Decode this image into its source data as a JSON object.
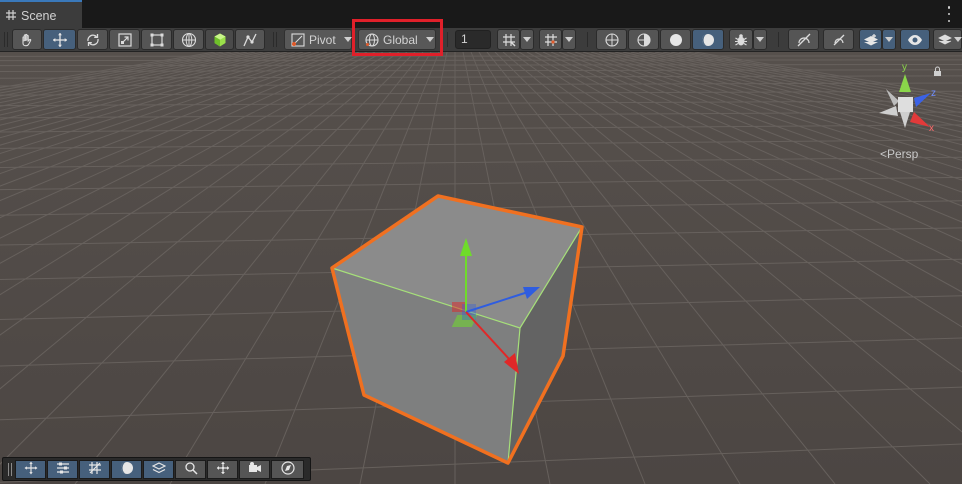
{
  "tab": {
    "title": "Scene"
  },
  "toolbar": {
    "tools": [
      "view-tool",
      "move-tool",
      "rotate-tool",
      "scale-tool",
      "rect-tool",
      "transform-tool",
      "custom-tool",
      "component-tool"
    ],
    "active_tool": "move-tool",
    "pivot_label": "Pivot",
    "global_label": "Global",
    "increment_value": "1"
  },
  "viewport": {
    "projection_label": "<Persp",
    "gizmo_axes": [
      "y",
      "z",
      "x"
    ]
  },
  "overlays": [
    "move",
    "layers",
    "grid",
    "orientation",
    "navigation",
    "search",
    "snapping",
    "camera",
    "compass"
  ],
  "colors": {
    "accent_blue": "#3a79bb",
    "highlight_red": "#e0202a",
    "selection_outline": "#f07020",
    "axis_x": "#e02828",
    "axis_y": "#6fdc2a",
    "axis_z": "#2f5de0"
  }
}
